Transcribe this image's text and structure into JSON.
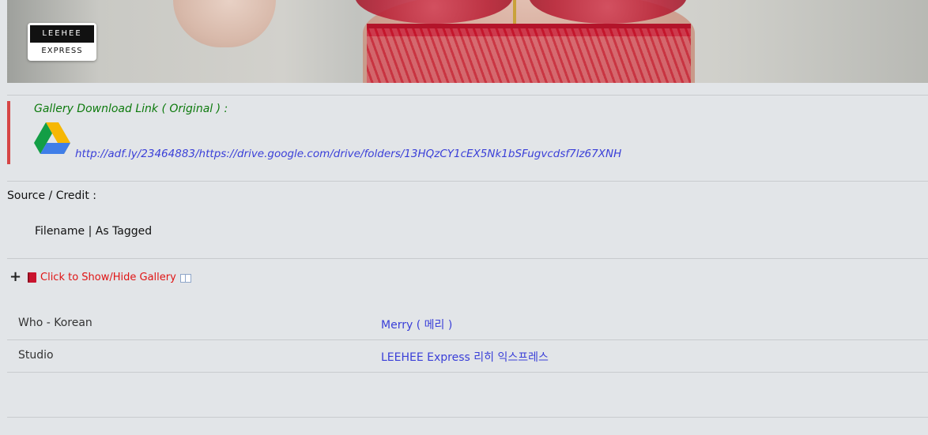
{
  "logo": {
    "line1": "LEEHEE",
    "line2": "EXPRESS"
  },
  "download": {
    "title": "Gallery Download Link ( Original ) :",
    "icon": "google-drive-icon",
    "link_text": "http://adf.ly/23464883/https://drive.google.com/drive/folders/13HQzCY1cEX5Nk1bSFugvcdsf7lz67XNH"
  },
  "source": {
    "label": "Source / Credit :",
    "value": "Filename | As Tagged"
  },
  "gallery_toggle": {
    "label": "Click to Show/Hide Gallery",
    "color": "#e01414"
  },
  "info_rows": [
    {
      "label": "Who - Korean",
      "value": "Merry ( 메리 )"
    },
    {
      "label": "Studio",
      "value": "LEEHEE Express 리히 익스프레스"
    }
  ],
  "colors": {
    "link": "#3a3fd8",
    "download_title": "#0d7a0d",
    "quote_bar": "#d64545",
    "background": "#e2e5e8"
  }
}
